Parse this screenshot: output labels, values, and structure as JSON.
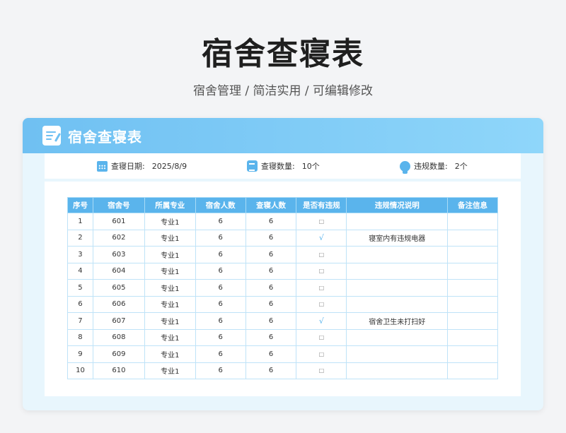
{
  "page": {
    "title": "宿舍查寝表",
    "subtitle": "宿舍管理 / 简洁实用 /  可编辑修改"
  },
  "card": {
    "title": "宿舍查寝表",
    "info": {
      "date_label": "查寝日期:",
      "date_value": "2025/8/9",
      "count_label": "查寝数量:",
      "count_value": "10个",
      "violation_label": "违规数量:",
      "violation_value": "2个"
    }
  },
  "table": {
    "headers": [
      "序号",
      "宿舍号",
      "所属专业",
      "宿舍人数",
      "查寝人数",
      "是否有违规",
      "违规情况说明",
      "备注信息"
    ],
    "rows": [
      [
        "1",
        "601",
        "专业1",
        "6",
        "6",
        "□",
        "",
        ""
      ],
      [
        "2",
        "602",
        "专业1",
        "6",
        "6",
        "√",
        "寝室内有违规电器",
        ""
      ],
      [
        "3",
        "603",
        "专业1",
        "6",
        "6",
        "□",
        "",
        ""
      ],
      [
        "4",
        "604",
        "专业1",
        "6",
        "6",
        "□",
        "",
        ""
      ],
      [
        "5",
        "605",
        "专业1",
        "6",
        "6",
        "□",
        "",
        ""
      ],
      [
        "6",
        "606",
        "专业1",
        "6",
        "6",
        "□",
        "",
        ""
      ],
      [
        "7",
        "607",
        "专业1",
        "6",
        "6",
        "√",
        "宿舍卫生未打扫好",
        ""
      ],
      [
        "8",
        "608",
        "专业1",
        "6",
        "6",
        "□",
        "",
        ""
      ],
      [
        "9",
        "609",
        "专业1",
        "6",
        "6",
        "□",
        "",
        ""
      ],
      [
        "10",
        "610",
        "专业1",
        "6",
        "6",
        "□",
        "",
        ""
      ]
    ]
  },
  "colors": {
    "accent": "#5ab4ec",
    "header_gradient_start": "#6fc0f2",
    "header_gradient_end": "#8fd6fa"
  }
}
